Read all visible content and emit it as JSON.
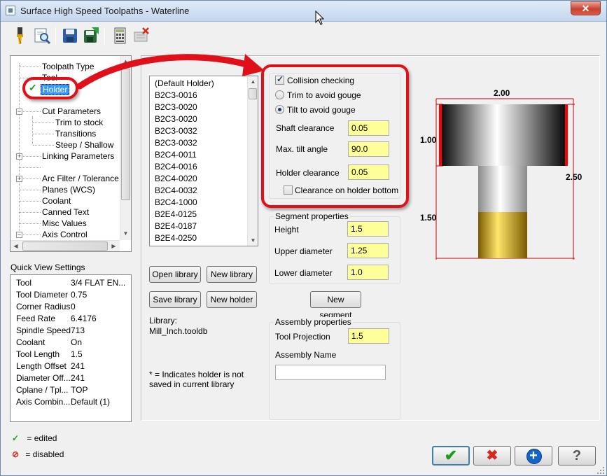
{
  "window": {
    "title": "Surface High Speed Toolpaths - Waterline",
    "close_glyph": "✕"
  },
  "toolbar": {
    "icons": [
      "tool-icon",
      "zoom-preview-icon",
      "save-icon",
      "load-icon",
      "calculator-icon",
      "disabled-delete-icon"
    ]
  },
  "tree": {
    "items": [
      {
        "label": "Toolpath Type"
      },
      {
        "label": "Tool"
      },
      {
        "label": "Holder",
        "selected": true
      },
      {
        "label": "Cut Parameters"
      },
      {
        "label": "Trim to stock"
      },
      {
        "label": "Transitions"
      },
      {
        "label": "Steep / Shallow"
      },
      {
        "label": "Linking Parameters"
      },
      {
        "label": "Arc Filter / Tolerance"
      },
      {
        "label": "Planes (WCS)"
      },
      {
        "label": "Coolant"
      },
      {
        "label": "Canned Text"
      },
      {
        "label": "Misc Values"
      },
      {
        "label": "Axis Control"
      }
    ],
    "expander_plus": "+",
    "expander_minus": "−"
  },
  "quick_view": {
    "title": "Quick View Settings",
    "rows": [
      {
        "label": "Tool",
        "value": "3/4 FLAT EN..."
      },
      {
        "label": "Tool Diameter",
        "value": "0.75"
      },
      {
        "label": "Corner Radius",
        "value": "0"
      },
      {
        "label": "Feed Rate",
        "value": "6.4176"
      },
      {
        "label": "Spindle Speed",
        "value": "713"
      },
      {
        "label": "Coolant",
        "value": "On"
      },
      {
        "label": "Tool Length",
        "value": "1.5"
      },
      {
        "label": "Length Offset",
        "value": "241"
      },
      {
        "label": "Diameter Off...",
        "value": "241"
      },
      {
        "label": "Cplane / Tpl...",
        "value": "TOP"
      },
      {
        "label": "Axis Combin...",
        "value": "Default (1)"
      }
    ]
  },
  "legend": {
    "edited": "= edited",
    "disabled": "= disabled"
  },
  "holder_list": {
    "items": [
      "(Default Holder)",
      "B2C3-0016",
      "B2C3-0020",
      "B2C3-0020",
      "B2C3-0032",
      "B2C3-0032",
      "B2C4-0011",
      "B2C4-0016",
      "B2C4-0020",
      "B2C4-0032",
      "B2C4-1000",
      "B2E4-0125",
      "B2E4-0187",
      "B2E4-0250"
    ]
  },
  "library": {
    "open_label": "Open library",
    "new_label": "New library",
    "save_label": "Save library",
    "new_holder_label": "New holder",
    "library_label": "Library:",
    "library_value": "Mill_Inch.tooldb",
    "note": "* = Indicates holder is not saved in current library"
  },
  "collision": {
    "checkbox_label": "Collision checking",
    "checked": true,
    "radio_trim": "Trim to avoid gouge",
    "radio_tilt": "Tilt to avoid gouge",
    "selected": "tilt",
    "shaft_clearance_label": "Shaft clearance",
    "shaft_clearance_value": "0.05",
    "max_tilt_label": "Max. tilt angle",
    "max_tilt_value": "90.0",
    "holder_clearance_label": "Holder clearance",
    "holder_clearance_value": "0.05",
    "bottom_checkbox_label": "Clearance on holder bottom",
    "bottom_checked": false
  },
  "segment": {
    "title": "Segment properties",
    "height_label": "Height",
    "height_value": "1.5",
    "upper_label": "Upper diameter",
    "upper_value": "1.25",
    "lower_label": "Lower diameter",
    "lower_value": "1.0",
    "new_segment_label": "New segment"
  },
  "assembly": {
    "title": "Assembly properties",
    "projection_label": "Tool Projection",
    "projection_value": "1.5",
    "name_label": "Assembly Name",
    "name_value": ""
  },
  "preview": {
    "top_width": "2.00",
    "holder_height": "1.00",
    "total_height": "2.50",
    "tool_height": "1.50"
  },
  "buttons": {
    "ok_glyph": "✔",
    "cancel_glyph": "✖",
    "apply_glyph": "+",
    "help_glyph": "?"
  },
  "colors": {
    "annotation_red": "#e0101a",
    "field_yellow": "#ffff99",
    "ok_green": "#1e9b1e",
    "cancel_red": "#d8281c",
    "apply_blue": "#1565c8"
  }
}
